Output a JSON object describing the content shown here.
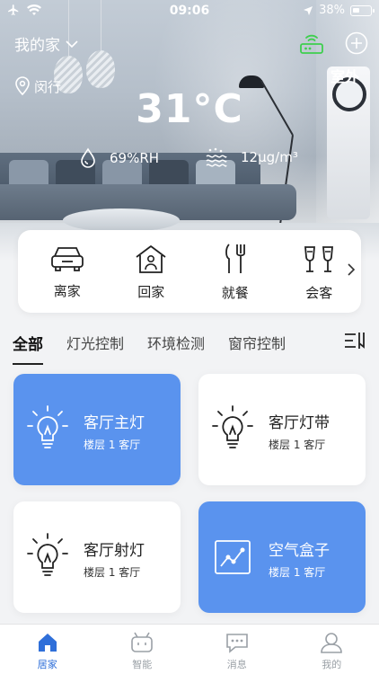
{
  "status_bar": {
    "time": "09:06",
    "battery": "38%"
  },
  "header": {
    "home_name": "我的家",
    "location": "闵行",
    "outdoor_label": "室外",
    "temperature": "31°C",
    "humidity": "69%RH",
    "pm": "12μg/m³"
  },
  "scenes": [
    {
      "label": "离家",
      "icon": "car-icon"
    },
    {
      "label": "回家",
      "icon": "house-icon"
    },
    {
      "label": "就餐",
      "icon": "cutlery-icon"
    },
    {
      "label": "会客",
      "icon": "glasses-icon"
    }
  ],
  "tabs": [
    {
      "label": "全部",
      "active": true
    },
    {
      "label": "灯光控制",
      "active": false
    },
    {
      "label": "环境检测",
      "active": false
    },
    {
      "label": "窗帘控制",
      "active": false
    }
  ],
  "devices": [
    {
      "name": "客厅主灯",
      "location": "楼层 1 客厅",
      "icon": "lightbulb-icon",
      "on": true
    },
    {
      "name": "客厅灯带",
      "location": "楼层 1 客厅",
      "icon": "lightbulb-icon",
      "on": false
    },
    {
      "name": "客厅射灯",
      "location": "楼层 1 客厅",
      "icon": "lightbulb-icon",
      "on": false
    },
    {
      "name": "空气盒子",
      "location": "楼层 1 客厅",
      "icon": "chart-icon",
      "on": true
    }
  ],
  "nav": [
    {
      "label": "居家",
      "icon": "home-icon",
      "active": true
    },
    {
      "label": "智能",
      "icon": "robot-icon",
      "active": false
    },
    {
      "label": "消息",
      "icon": "message-icon",
      "active": false
    },
    {
      "label": "我的",
      "icon": "user-icon",
      "active": false
    }
  ],
  "colors": {
    "accent": "#5a93ee",
    "nav_active": "#2f6fd9",
    "router_green": "#3ecf4e"
  }
}
